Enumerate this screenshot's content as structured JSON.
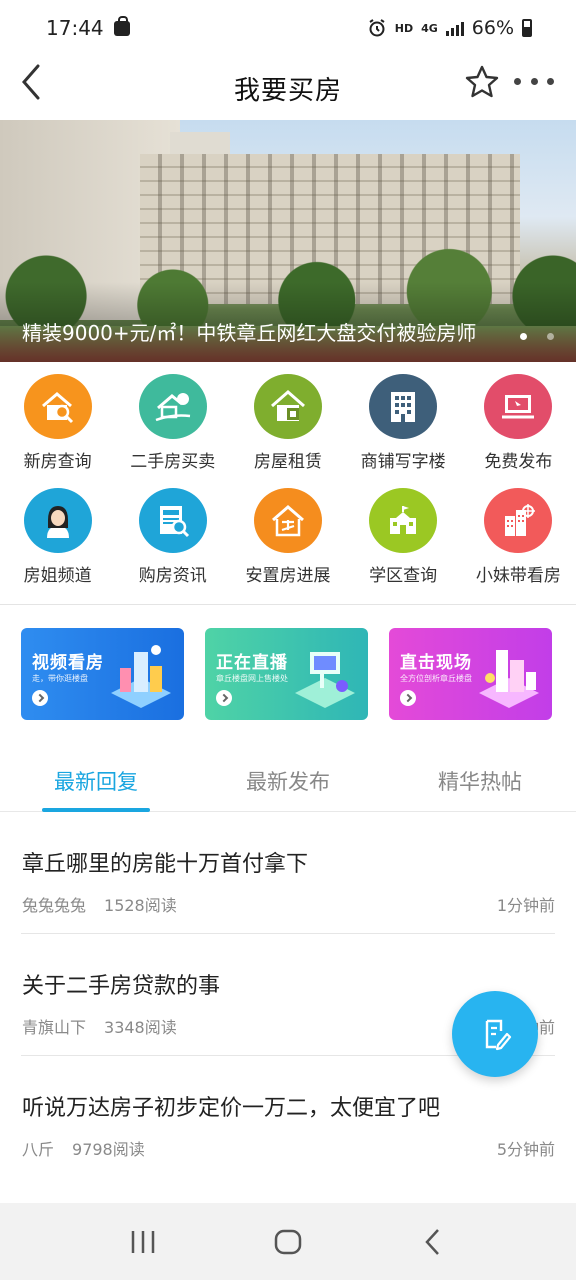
{
  "status_bar": {
    "time": "17:44",
    "hd": "HD",
    "network": "4G",
    "battery": "66%"
  },
  "header": {
    "title": "我要买房"
  },
  "banner": {
    "caption": "精装9000+元/㎡！中铁章丘网红大盘交付被验房师"
  },
  "grid": [
    {
      "label": "新房查询",
      "icon": "house-search-icon",
      "color": "#f7941d"
    },
    {
      "label": "二手房买卖",
      "icon": "house-money-icon",
      "color": "#3fba9c"
    },
    {
      "label": "房屋租赁",
      "icon": "house-rent-icon",
      "color": "#7fae2e"
    },
    {
      "label": "商铺写字楼",
      "icon": "office-building-icon",
      "color": "#3e5f7a"
    },
    {
      "label": "免费发布",
      "icon": "laptop-publish-icon",
      "color": "#e24d6a"
    },
    {
      "label": "房姐频道",
      "icon": "woman-avatar-icon",
      "color": "#1fa5d8"
    },
    {
      "label": "购房资讯",
      "icon": "news-search-icon",
      "color": "#1fa5d8"
    },
    {
      "label": "安置房进展",
      "icon": "resettlement-house-icon",
      "color": "#f58d1e"
    },
    {
      "label": "学区查询",
      "icon": "school-icon",
      "color": "#9bc823"
    },
    {
      "label": "小妹带看房",
      "icon": "building-target-icon",
      "color": "#f25a5a"
    }
  ],
  "promos": [
    {
      "title": "视频看房",
      "sub": "走，带你逛楼盘",
      "color_a": "#2f8df0",
      "color_b": "#1a6fe0",
      "icon": "video-tour-icon"
    },
    {
      "title": "正在直播",
      "sub": "章丘楼盘网上售楼处",
      "color_a": "#4fd3a6",
      "color_b": "#2fb6b6",
      "icon": "live-stream-icon"
    },
    {
      "title": "直击现场",
      "sub": "全方位剖析章丘楼盘",
      "color_a": "#e44ad8",
      "color_b": "#c23ee8",
      "icon": "on-site-icon"
    }
  ],
  "tabs": [
    {
      "label": "最新回复",
      "active": true
    },
    {
      "label": "最新发布",
      "active": false
    },
    {
      "label": "精华热帖",
      "active": false
    }
  ],
  "posts": [
    {
      "title": "章丘哪里的房能十万首付拿下",
      "author": "兔兔兔兔",
      "reads": "1528阅读",
      "time": "1分钟前"
    },
    {
      "title": "关于二手房贷款的事",
      "author": "青旗山下",
      "reads": "3348阅读",
      "time": "2分钟前"
    },
    {
      "title": "听说万达房子初步定价一万二，太便宜了吧",
      "author": "八斤",
      "reads": "9798阅读",
      "time": "5分钟前"
    }
  ],
  "colors": {
    "accent": "#1aa6e0",
    "fab": "#28b4f0"
  }
}
